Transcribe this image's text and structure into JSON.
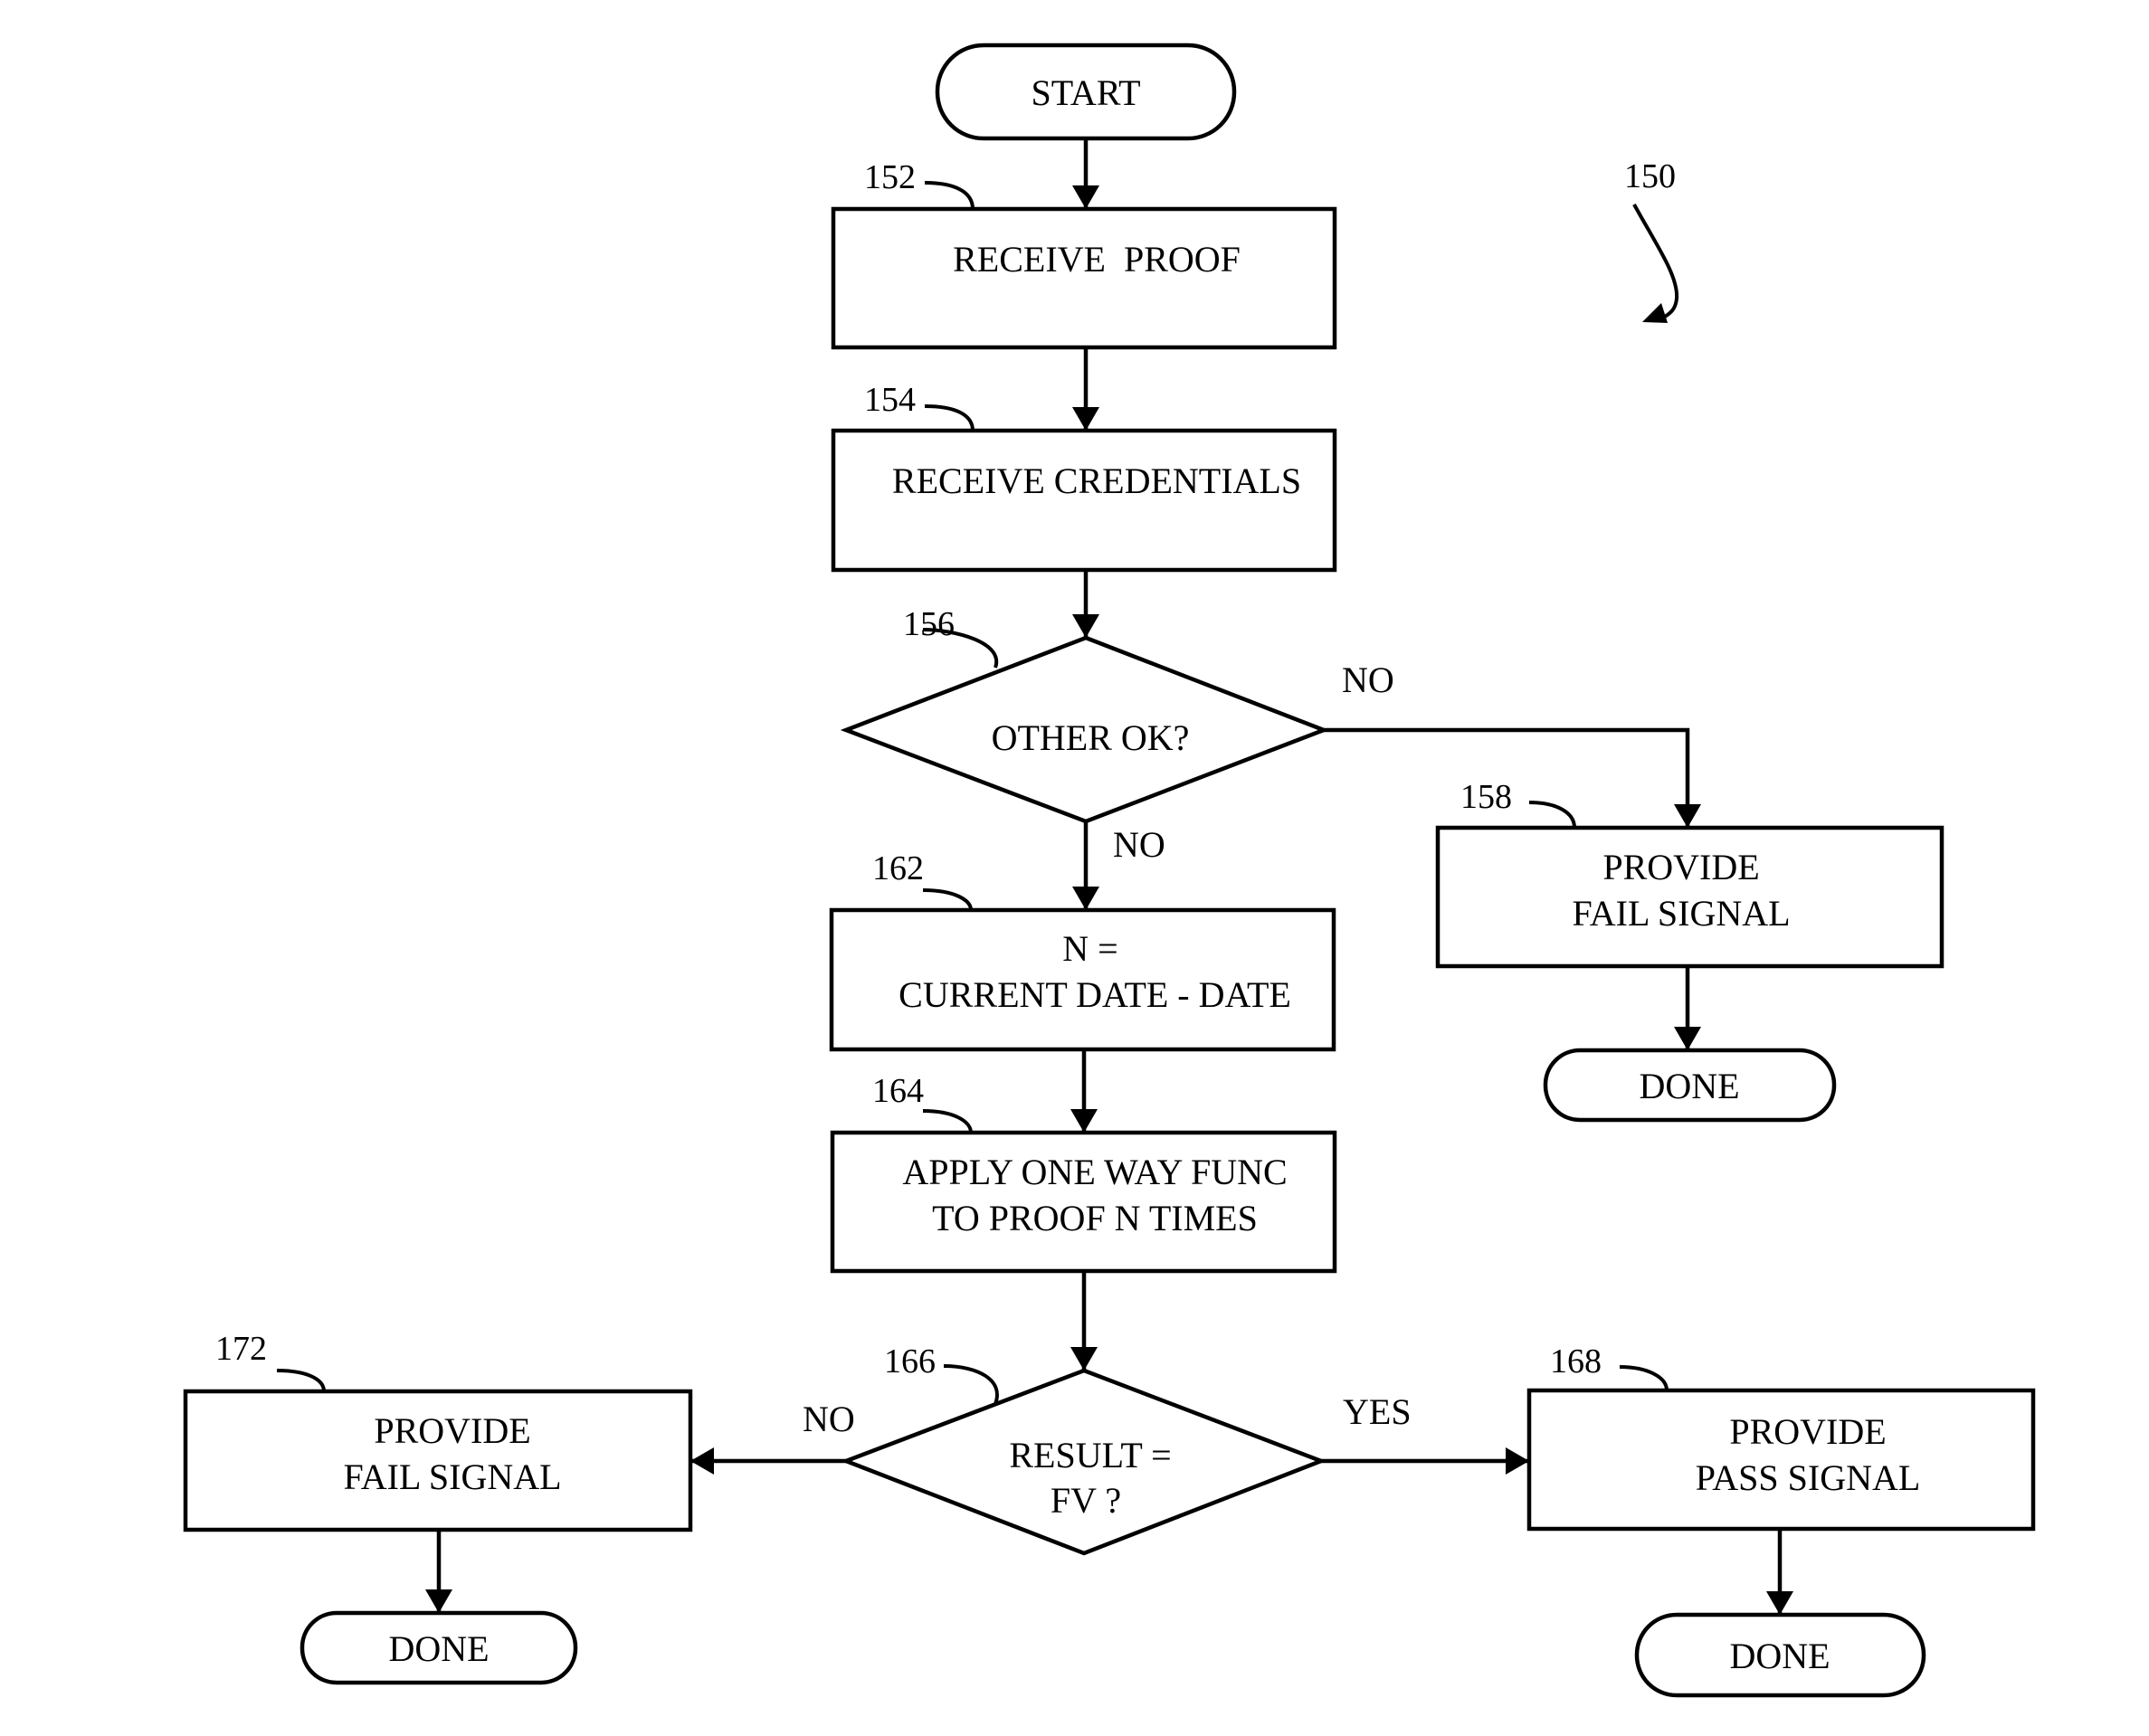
{
  "figure": {
    "ref": "150",
    "start_label": "START",
    "steps": {
      "s152": {
        "ref": "152",
        "lines": [
          "RECEIVE  PROOF"
        ]
      },
      "s154": {
        "ref": "154",
        "lines": [
          "RECEIVE CREDENTIALS"
        ]
      },
      "s156": {
        "ref": "156",
        "lines": [
          "OTHER OK?"
        ]
      },
      "s158": {
        "ref": "158",
        "lines": [
          "PROVIDE",
          "FAIL SIGNAL"
        ]
      },
      "s162": {
        "ref": "162",
        "lines": [
          "N =",
          "CURRENT DATE - DATE"
        ]
      },
      "s164": {
        "ref": "164",
        "lines": [
          "APPLY ONE WAY FUNC",
          "TO PROOF N TIMES"
        ]
      },
      "s166": {
        "ref": "166",
        "lines": [
          "RESULT =",
          "FV ?"
        ]
      },
      "s168": {
        "ref": "168",
        "lines": [
          "PROVIDE",
          "PASS SIGNAL"
        ]
      },
      "s172": {
        "ref": "172",
        "lines": [
          "PROVIDE",
          "FAIL SIGNAL"
        ]
      }
    },
    "done_label": "DONE",
    "branch_labels": {
      "b156_right": "NO",
      "b156_down": "NO",
      "b166_left": "NO",
      "b166_right": "YES"
    }
  }
}
